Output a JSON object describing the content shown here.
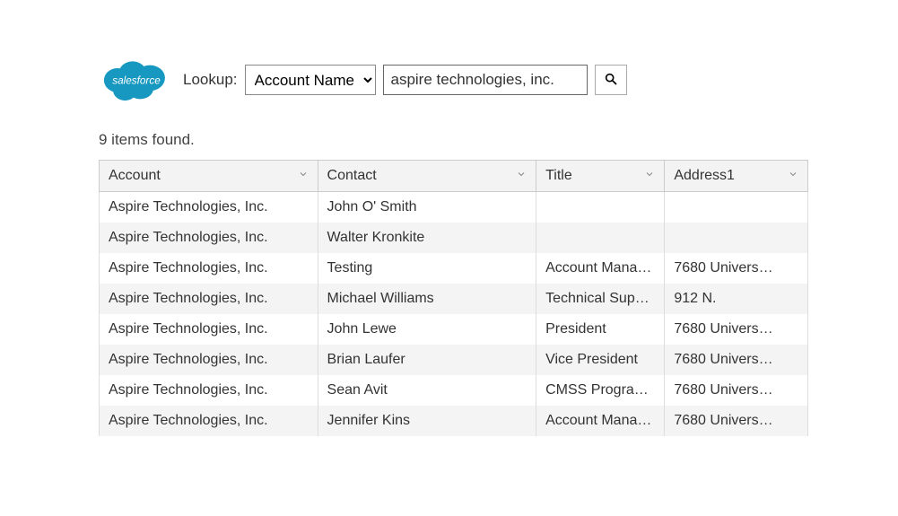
{
  "brand": {
    "name": "salesforce",
    "color": "#1798c1"
  },
  "lookup": {
    "label": "Lookup:",
    "selected_option": "Account Name",
    "input_value": "aspire technologies, inc."
  },
  "results": {
    "count_text": "9 items found.",
    "columns": [
      {
        "key": "account",
        "label": "Account"
      },
      {
        "key": "contact",
        "label": "Contact"
      },
      {
        "key": "title",
        "label": "Title"
      },
      {
        "key": "address1",
        "label": "Address1"
      }
    ],
    "rows": [
      {
        "account": "Aspire Technologies, Inc.",
        "contact": "John O' Smith",
        "title": "",
        "address1": ""
      },
      {
        "account": "Aspire Technologies, Inc.",
        "contact": "Walter Kronkite",
        "title": "",
        "address1": ""
      },
      {
        "account": "Aspire Technologies, Inc.",
        "contact": "Testing",
        "title": "Account Mana…",
        "address1": "7680 Univers…"
      },
      {
        "account": "Aspire Technologies, Inc.",
        "contact": "Michael Williams",
        "title": "Technical Sup…",
        "address1": "912 N."
      },
      {
        "account": "Aspire Technologies, Inc.",
        "contact": "John Lewe",
        "title": "President",
        "address1": "7680 Univers…"
      },
      {
        "account": "Aspire Technologies, Inc.",
        "contact": "Brian Laufer",
        "title": "Vice President",
        "address1": "7680 Univers…"
      },
      {
        "account": "Aspire Technologies, Inc.",
        "contact": "Sean Avit",
        "title": "CMSS Progra…",
        "address1": "7680 Univers…"
      },
      {
        "account": "Aspire Technologies, Inc.",
        "contact": "Jennifer Kins",
        "title": "Account Mana…",
        "address1": "7680 Univers…"
      }
    ]
  }
}
